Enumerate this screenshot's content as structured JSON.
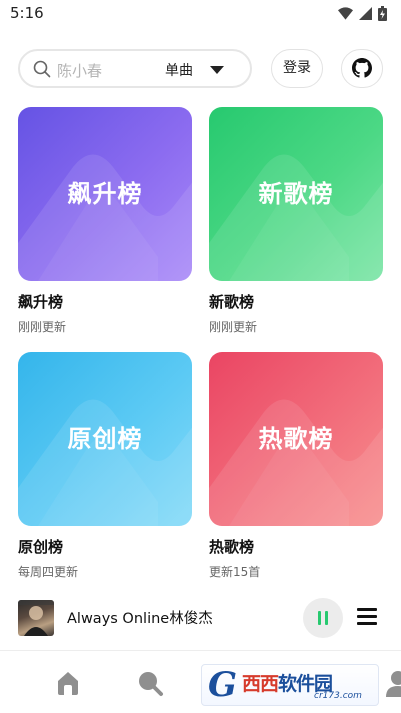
{
  "status_bar": {
    "time": "5:16",
    "icons": [
      "wifi-icon",
      "signal-icon",
      "battery-charging-icon"
    ]
  },
  "header": {
    "search": {
      "placeholder": "陈小春",
      "type": "单曲",
      "icon": "search-icon",
      "dropdown_icon": "caret-down-icon"
    },
    "login_label": "登录",
    "github_icon": "github-icon"
  },
  "charts": [
    {
      "cover_text": "飙升榜",
      "title": "飙升榜",
      "subtitle": "刚刚更新",
      "color": "#7b62ee"
    },
    {
      "cover_text": "新歌榜",
      "title": "新歌榜",
      "subtitle": "刚刚更新",
      "color": "#3ccf7b"
    },
    {
      "cover_text": "原创榜",
      "title": "原创榜",
      "subtitle": "每周四更新",
      "color": "#4cc2f1"
    },
    {
      "cover_text": "热歌榜",
      "title": "热歌榜",
      "subtitle": "更新15首",
      "color": "#ef5a6f"
    }
  ],
  "player": {
    "track": "Always Online林俊杰",
    "state": "playing",
    "accent": "#27c96f"
  },
  "bottom_nav": {
    "items": [
      "home-icon",
      "search-icon",
      "profile-icon"
    ]
  },
  "watermark": {
    "logo_letter": "G",
    "text_a": "西西",
    "text_b": "软件园",
    "url": "cr173.com"
  }
}
